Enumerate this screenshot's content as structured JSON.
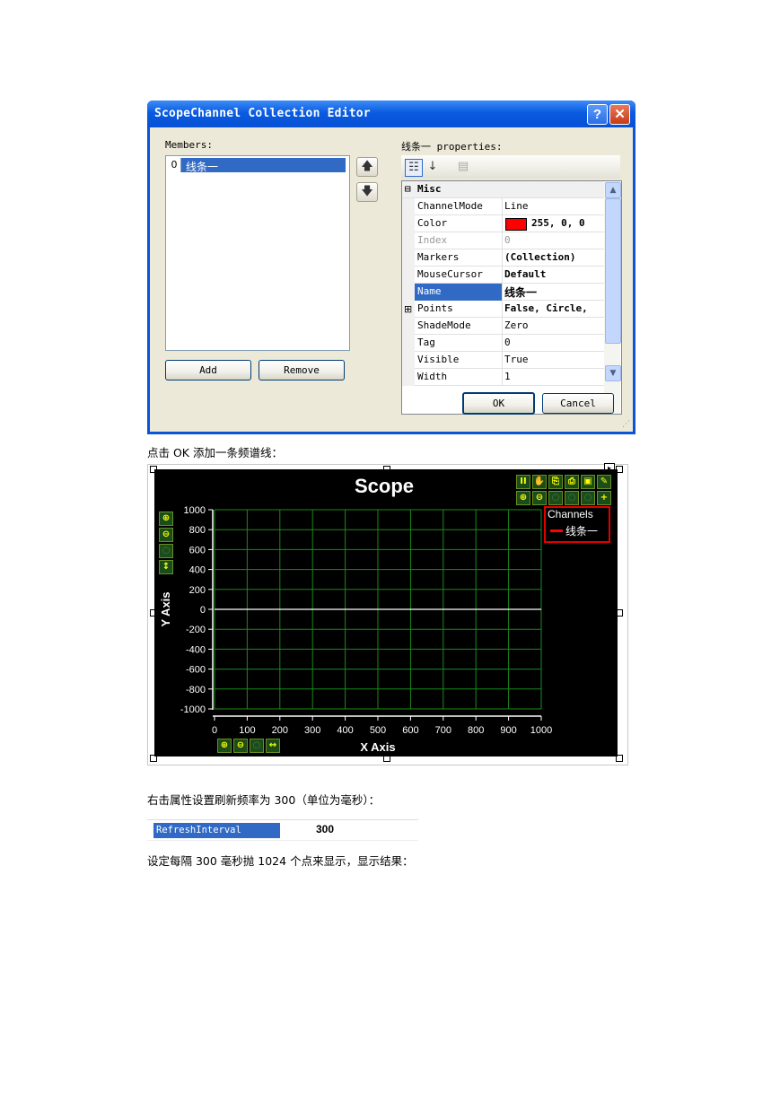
{
  "dialog": {
    "title": "ScopeChannel Collection Editor",
    "help_glyph": "?",
    "close_glyph": "✕",
    "members_label": "Members:",
    "members": [
      {
        "index": "0",
        "name": "线条一"
      }
    ],
    "props_label": "线条一 properties:",
    "category": "Misc",
    "properties": [
      {
        "name": "ChannelMode",
        "value": "Line"
      },
      {
        "name": "Color",
        "value": "255, 0, 0",
        "swatch": "#ff0000"
      },
      {
        "name": "Index",
        "value": "0"
      },
      {
        "name": "Markers",
        "value": "(Collection)"
      },
      {
        "name": "MouseCursor",
        "value": "Default"
      },
      {
        "name": "Name",
        "value": "线条一"
      },
      {
        "name": "Points",
        "value": "False, Circle,"
      },
      {
        "name": "ShadeMode",
        "value": "Zero"
      },
      {
        "name": "Tag",
        "value": "0"
      },
      {
        "name": "Visible",
        "value": "True"
      },
      {
        "name": "Width",
        "value": "1"
      }
    ],
    "add_label": "Add",
    "remove_label": "Remove",
    "ok_label": "OK",
    "cancel_label": "Cancel",
    "accent": "#316ac5"
  },
  "caption1": "点击 OK 添加一条频谱线：",
  "scope": {
    "title": "Scope",
    "legend_title": "Channels",
    "legend_entry": "线条一",
    "series_color": "#ff0000",
    "grid_color": "#1a8a1a",
    "toolbar_icons": [
      "pause-icon",
      "hand-icon",
      "copy-icon",
      "print-icon",
      "save-icon",
      "wrench-icon"
    ],
    "zoom_icons": [
      "zoom-in-icon",
      "zoom-out-icon",
      "zoom-fit-icon",
      "zoom-x-icon",
      "zoom-y-icon",
      "add-icon"
    ]
  },
  "chart_data": {
    "type": "line",
    "title": "Scope",
    "xlabel": "X Axis",
    "ylabel": "Y Axis",
    "xlim": [
      0,
      1000
    ],
    "ylim": [
      -1000,
      1000
    ],
    "x_ticks": [
      "0",
      "100",
      "200",
      "300",
      "400",
      "500",
      "600",
      "700",
      "800",
      "900",
      "1000"
    ],
    "y_ticks": [
      "1000",
      "800",
      "600",
      "400",
      "200",
      "0",
      "-200",
      "-400",
      "-600",
      "-800",
      "-1000"
    ],
    "grid": true,
    "legend_placement": "top-right",
    "series": [
      {
        "name": "线条一",
        "x": [
          0,
          1000
        ],
        "y": [
          0,
          0
        ]
      }
    ]
  },
  "caption2": "右击属性设置刷新频率为 300（单位为毫秒）：",
  "refresh": {
    "name": "RefreshInterval",
    "value": "300"
  },
  "caption3": "设定每隔 300 毫秒抛 1024 个点来显示，显示结果："
}
